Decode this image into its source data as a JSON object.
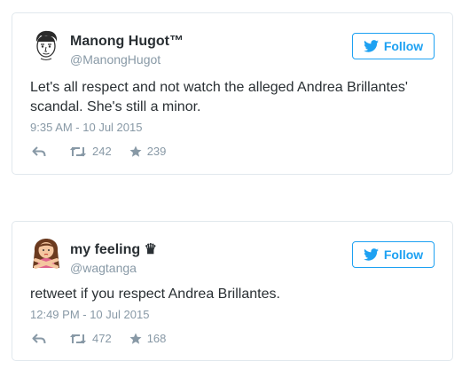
{
  "tweets": [
    {
      "display_name": "Manong Hugot™",
      "handle": "@ManongHugot",
      "follow_label": "Follow",
      "text": "Let's all respect and not watch the alleged Andrea Brillantes' scandal. She's still a minor.",
      "timestamp": "9:35 AM - 10 Jul 2015",
      "retweets": "242",
      "likes": "239",
      "avatar_icon": "cartoon-face-icon"
    },
    {
      "display_name": "my feeling ♛",
      "handle": "@wagtanga",
      "follow_label": "Follow",
      "text": "retweet if you respect Andrea Brillantes.",
      "timestamp": "12:49 PM - 10 Jul 2015",
      "retweets": "472",
      "likes": "168",
      "avatar_icon": "crossed-arms-emoji-icon"
    }
  ],
  "colors": {
    "accent": "#1da1f2",
    "muted": "#8899a6",
    "text": "#292f33",
    "border": "#e1e8ed"
  }
}
